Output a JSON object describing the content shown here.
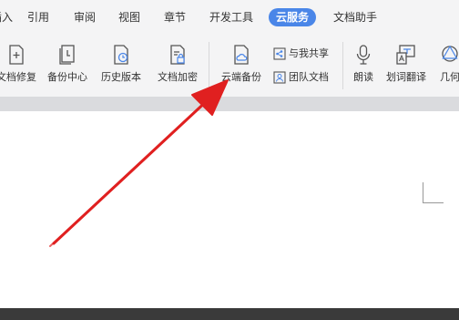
{
  "tabs": [
    "插入",
    "引用",
    "审阅",
    "视图",
    "章节",
    "开发工具",
    "云服务",
    "文档助手"
  ],
  "active_tab": "云服务",
  "ribbon": {
    "doc_repair": "文档修复",
    "backup_center": "备份中心",
    "history": "历史版本",
    "encrypt": "文档加密",
    "cloud_backup": "云端备份",
    "shared_with_me": "与我共享",
    "team_docs": "团队文档",
    "read_aloud": "朗读",
    "translate": "划词翻译",
    "geometry": "几何"
  },
  "colors": {
    "active_tab_bg": "#4a86e8",
    "annotation_arrow": "#e02020",
    "ribbon_bg": "#f4f4f5"
  }
}
